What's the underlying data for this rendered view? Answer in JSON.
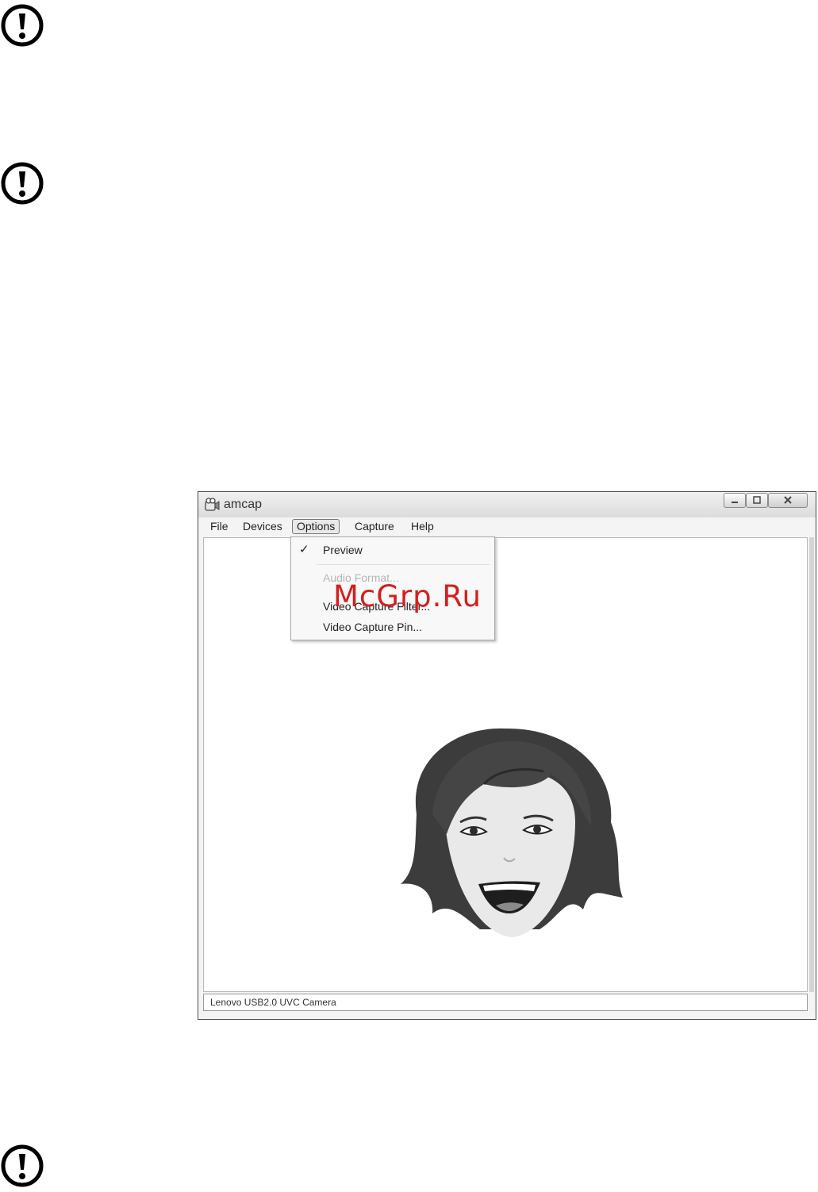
{
  "window": {
    "title": "amcap",
    "menu": [
      "File",
      "Devices",
      "Options",
      "Capture",
      "Help"
    ],
    "status_text": "Lenovo USB2.0 UVC Camera"
  },
  "options_menu": {
    "check_mark": "✓",
    "items": [
      {
        "label": "Preview",
        "checked": true,
        "enabled": true
      },
      {
        "label": "Audio Format...",
        "enabled": false
      },
      {
        "label": "Video Capture Filter...",
        "enabled": true
      },
      {
        "label": "Video Capture Pin...",
        "enabled": true
      }
    ]
  },
  "watermark": "McGrp.Ru",
  "icons": [
    "warning-icon",
    "app-camera-icon",
    "minimize-icon",
    "maximize-icon",
    "close-icon"
  ]
}
